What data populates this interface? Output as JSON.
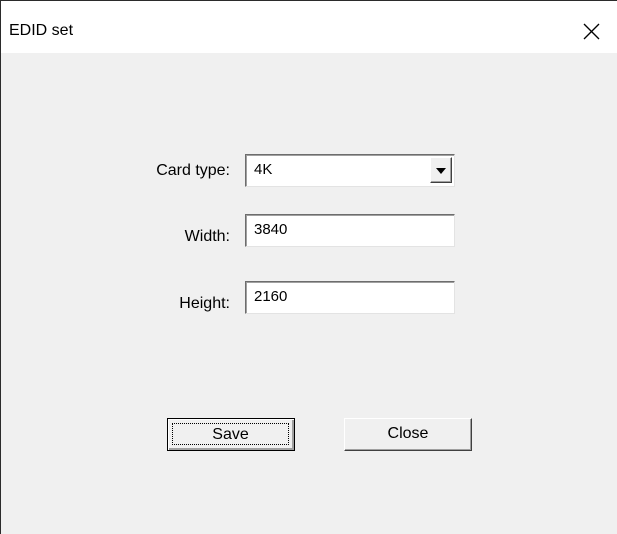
{
  "window": {
    "title": "EDID set",
    "close_icon": "close-icon"
  },
  "form": {
    "card_type": {
      "label": "Card type:",
      "selected": "4K"
    },
    "width": {
      "label": "Width:",
      "value": "3840"
    },
    "height": {
      "label": "Height:",
      "value": "2160"
    }
  },
  "buttons": {
    "save_label": "Save",
    "close_label": "Close"
  },
  "colors": {
    "dialog_bg": "#f0f0f0",
    "titlebar_bg": "#ffffff"
  }
}
